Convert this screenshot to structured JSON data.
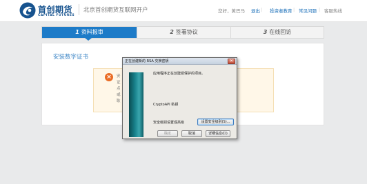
{
  "header": {
    "logo_cn": "首创期货",
    "logo_en": "CAPITAL FUTURES",
    "site_title": "北京首创期货互联网开户",
    "greeting": "您好，黄巴马",
    "logout": "退出",
    "investor_education": "投资者教育",
    "faq": "常见问题",
    "hotline": "客服热线",
    "separator": "|"
  },
  "tabs": [
    {
      "num": "1",
      "label": "资料报审",
      "active": true
    },
    {
      "num": "2",
      "label": "签署协议",
      "active": false
    },
    {
      "num": "3",
      "label": "在线回访",
      "active": false
    }
  ],
  "panel": {
    "title": "安装数字证书",
    "notice_lines": [
      "安",
      "证",
      "点",
      "或",
      "耿"
    ]
  },
  "dialog": {
    "title": "正在创建新的 RSA 交换密钥",
    "close": "✕",
    "line1": "应用程序正在创建受保护的项目。",
    "line2": "CryptoAPI 私钥",
    "line3": "安全级别设置成高级",
    "btn_set_level": "设置安全级别(S)...",
    "btn_ok": "确定",
    "btn_cancel": "取消",
    "btn_details": "详细信息(D)"
  },
  "colors": {
    "brand": "#17538f",
    "tab_active": "#1d7bc8",
    "link": "#1a6fb9",
    "error_icon": "#ea6c25"
  }
}
